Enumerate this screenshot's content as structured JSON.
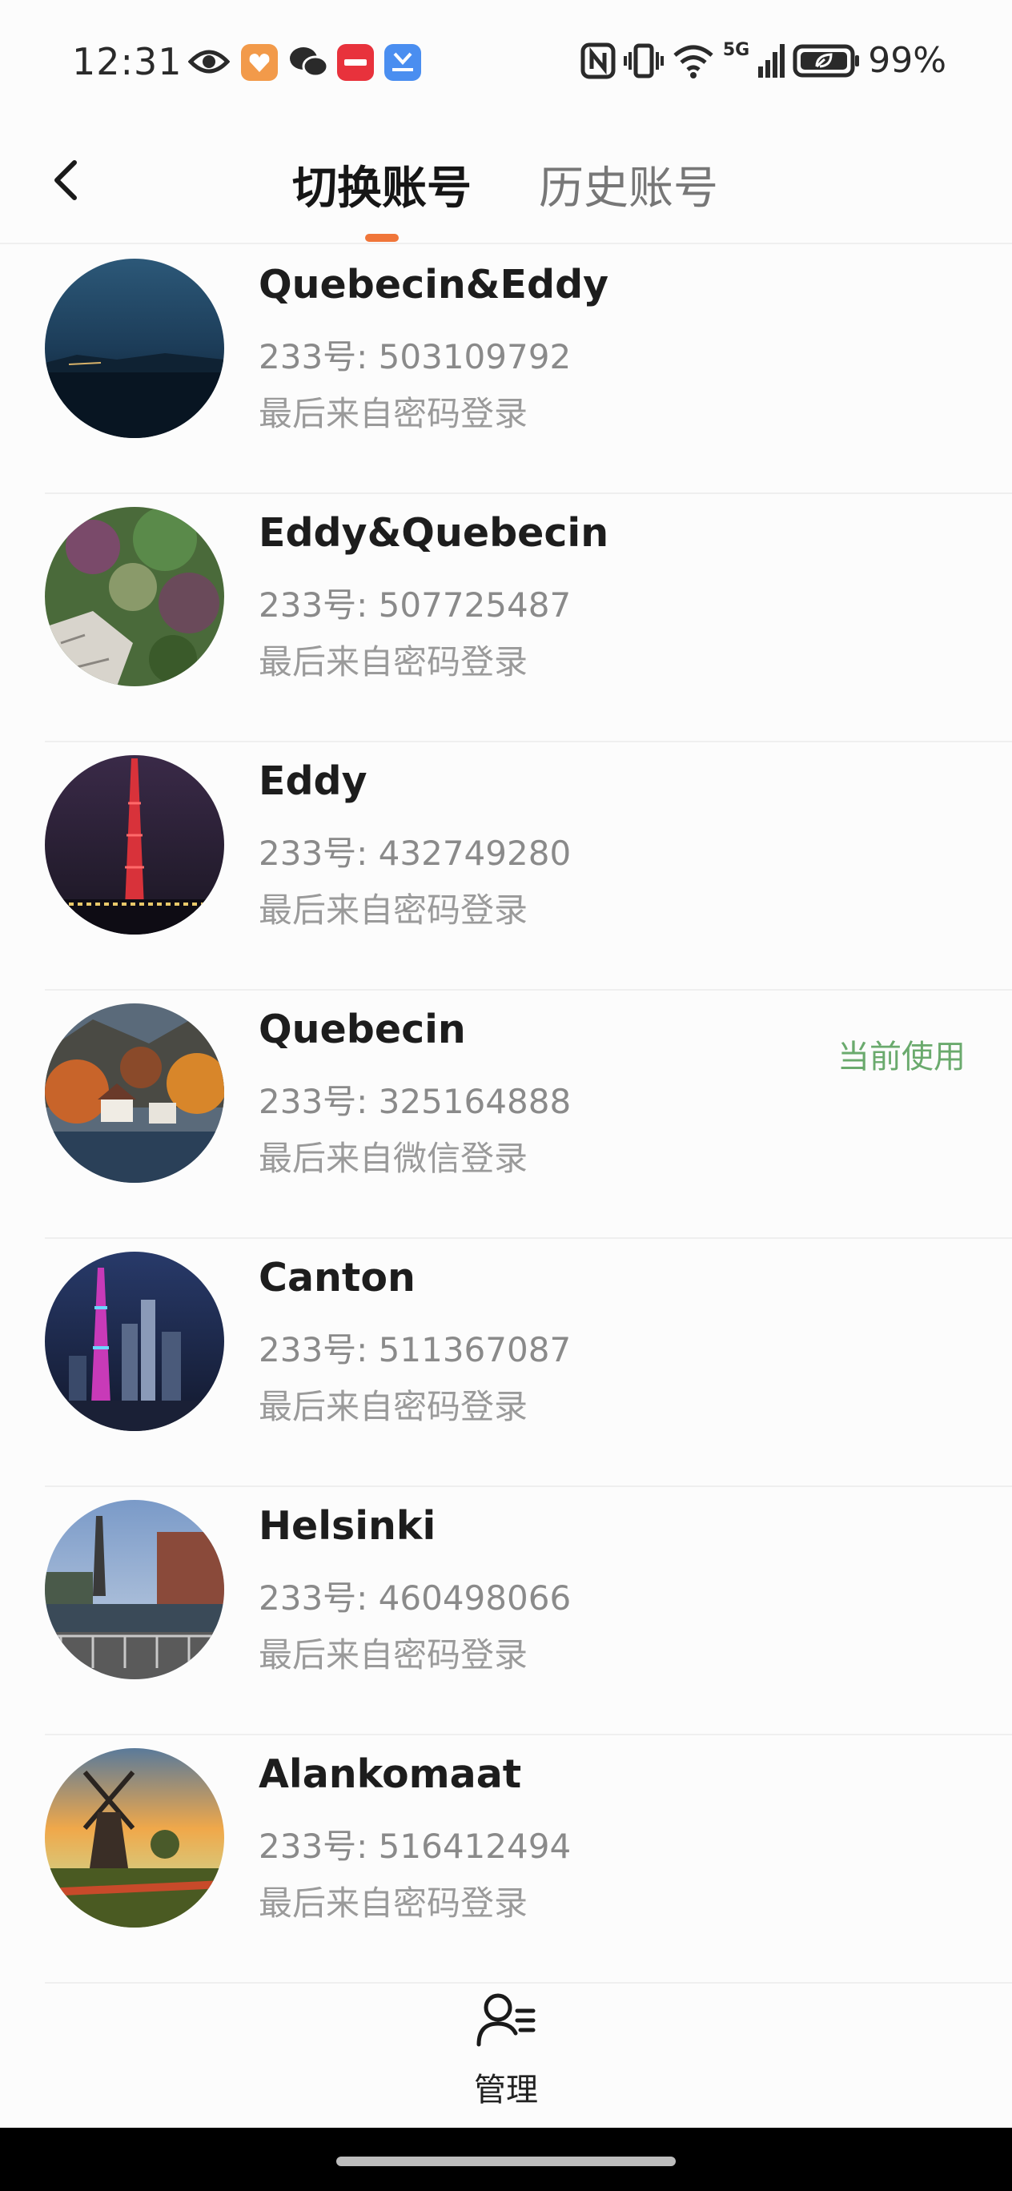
{
  "status_bar": {
    "time": "12:31",
    "battery": "99%",
    "network": "5G",
    "icons": [
      "eye-icon",
      "app-badge-orange",
      "wechat-icon",
      "xiaohongshu-icon",
      "honor-app-icon",
      "nfc-icon",
      "vibrate-icon",
      "wifi-icon",
      "signal-icon",
      "battery-icon"
    ]
  },
  "header": {
    "tabs": [
      {
        "label": "切换账号",
        "active": true
      },
      {
        "label": "历史账号",
        "active": false
      }
    ],
    "accent_color": "#f0763a"
  },
  "accounts": [
    {
      "name": "Quebecin&Eddy",
      "id": "233号: 503109792",
      "login": "最后来自密码登录",
      "current": "",
      "avatar": "night-lake-photo"
    },
    {
      "name": "Eddy&Quebecin",
      "id": "233号: 507725487",
      "login": "最后来自密码登录",
      "current": "",
      "avatar": "succulent-garden-photo"
    },
    {
      "name": "Eddy",
      "id": "233号: 432749280",
      "login": "最后来自密码登录",
      "current": "",
      "avatar": "canton-tower-night-photo"
    },
    {
      "name": "Quebecin",
      "id": "233号: 325164888",
      "login": "最后来自微信登录",
      "current": "当前使用",
      "avatar": "autumn-lakeside-village-photo"
    },
    {
      "name": "Canton",
      "id": "233号: 511367087",
      "login": "最后来自密码登录",
      "current": "",
      "avatar": "city-skyline-night-photo"
    },
    {
      "name": "Helsinki",
      "id": "233号: 460498066",
      "login": "最后来自密码登录",
      "current": "",
      "avatar": "canal-bridge-photo"
    },
    {
      "name": "Alankomaat",
      "id": "233号: 516412494",
      "login": "最后来自密码登录",
      "current": "",
      "avatar": "windmill-sunset-photo"
    }
  ],
  "current_color": "#6aaa6d",
  "manage": {
    "label": "管理",
    "icon": "user-manage-icon"
  }
}
